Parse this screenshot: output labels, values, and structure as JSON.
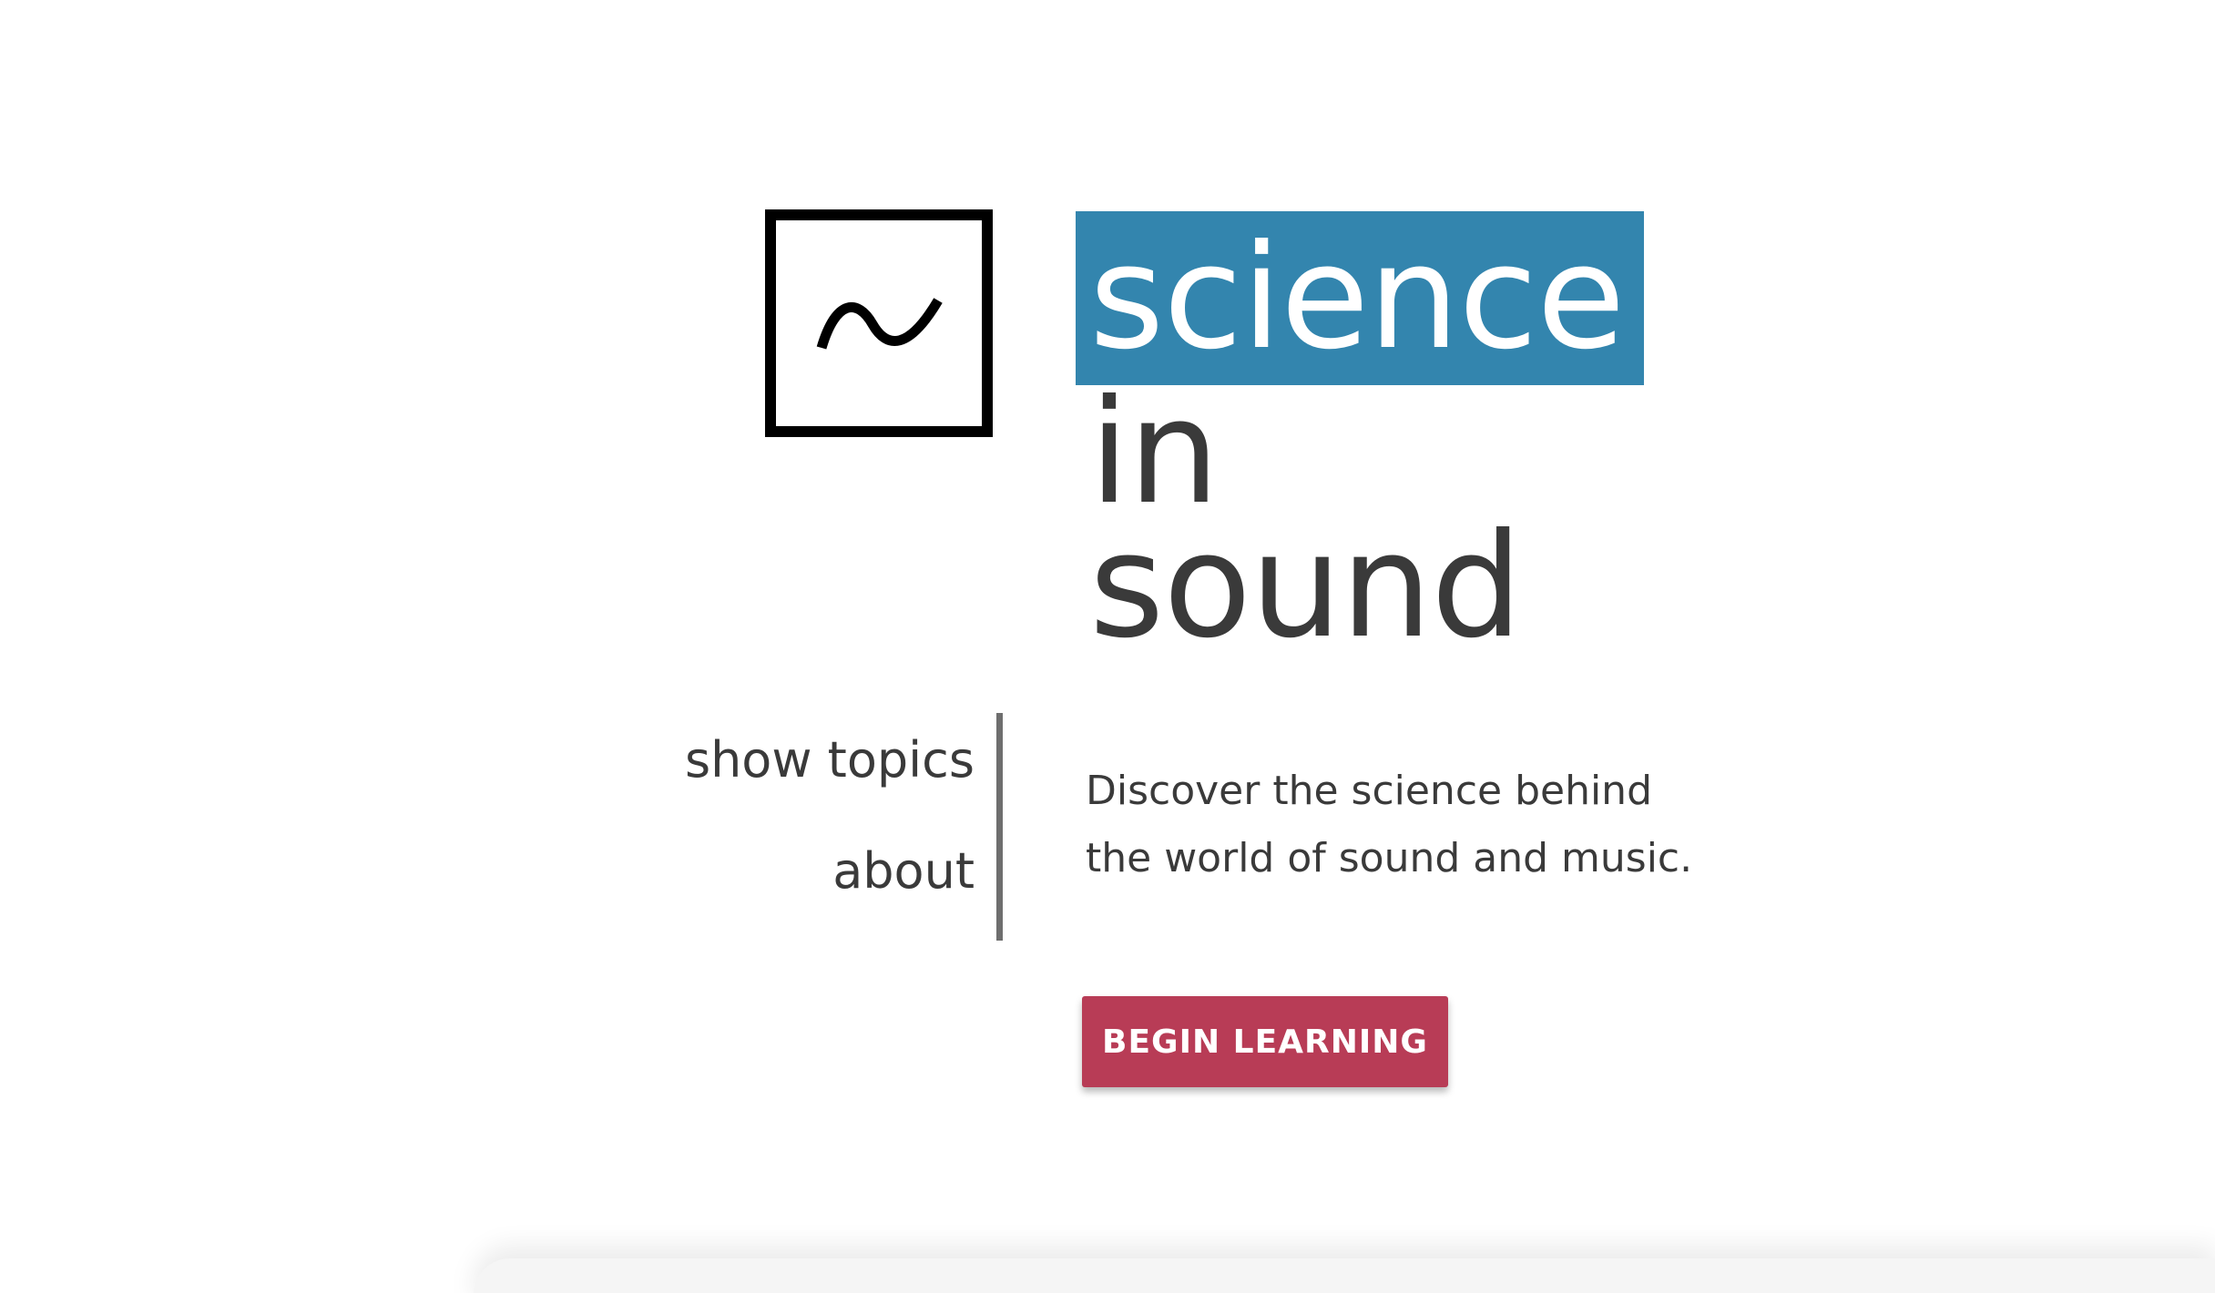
{
  "logo": {
    "icon": "sine-wave-icon"
  },
  "title": {
    "line1": "science",
    "line2": "in",
    "line3": "sound",
    "highlight_color": "#3385ae"
  },
  "nav": {
    "items": [
      {
        "label": "show topics"
      },
      {
        "label": "about"
      }
    ]
  },
  "tagline": {
    "line1": "Discover the science behind",
    "line2": "the world of sound and music."
  },
  "cta": {
    "label": "BEGIN LEARNING",
    "color": "#b83c56"
  }
}
